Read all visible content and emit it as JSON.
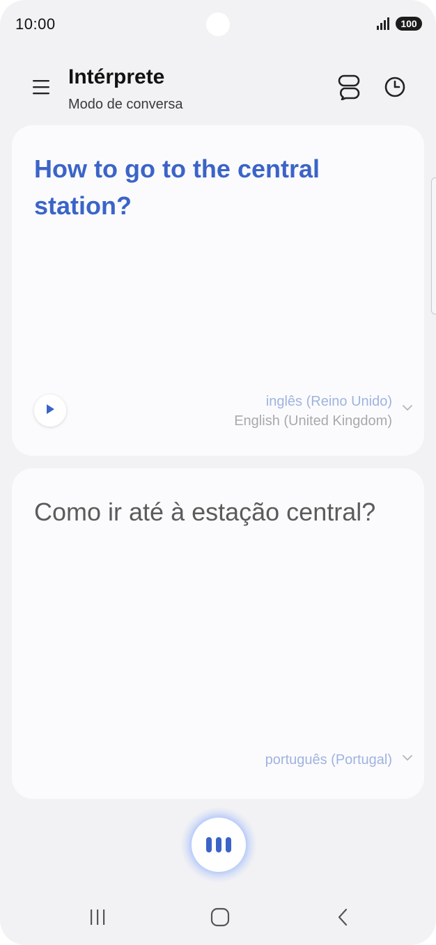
{
  "status_bar": {
    "time": "10:00",
    "battery": "100",
    "icons": [
      "signal-icon",
      "battery-icon"
    ]
  },
  "header": {
    "title": "Intérprete",
    "subtitle": "Modo de conversa",
    "icons": [
      "menu-icon",
      "conversation-icon",
      "history-icon"
    ]
  },
  "source_card": {
    "text": "How to go to the central station?",
    "language_primary": "inglês (Reino Unido)",
    "language_secondary": "English (United Kingdom)",
    "play_icon": "play-icon"
  },
  "target_card": {
    "text": "Como ir até à estação central?",
    "language_primary": "português (Portugal)"
  },
  "mic": {
    "icon": "listening-bars-icon",
    "accent": "#3b64c8"
  },
  "nav_bar": {
    "icons": [
      "recent-apps-icon",
      "home-icon",
      "back-icon"
    ]
  },
  "colors": {
    "accent_blue": "#3b64c8",
    "background": "#f2f2f4",
    "card": "#fbfbfd"
  }
}
